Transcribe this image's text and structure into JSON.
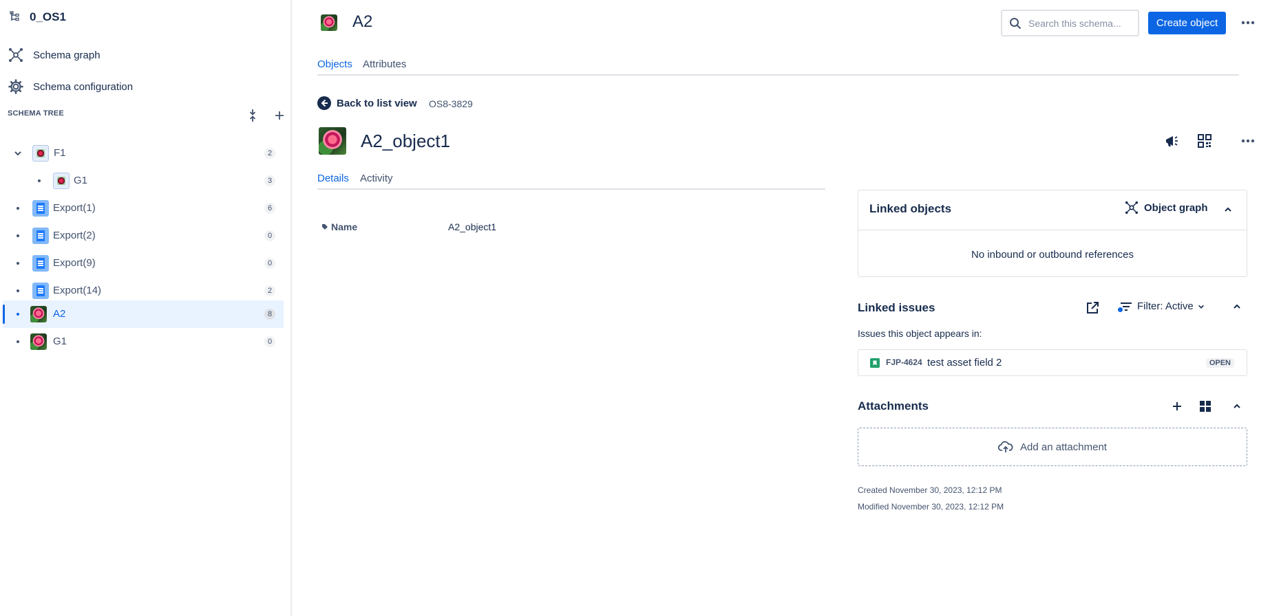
{
  "sidebar": {
    "schema_name": "0_OS1",
    "links": [
      {
        "label": "Schema graph",
        "icon": "schema-graph-icon"
      },
      {
        "label": "Schema configuration",
        "icon": "gear-icon"
      }
    ],
    "tree_heading": "SCHEMA TREE",
    "tree": [
      {
        "label": "F1",
        "count": "2"
      },
      {
        "label": "G1",
        "count": "3"
      },
      {
        "label": "Export(1)",
        "count": "6"
      },
      {
        "label": "Export(2)",
        "count": "0"
      },
      {
        "label": "Export(9)",
        "count": "0"
      },
      {
        "label": "Export(14)",
        "count": "2"
      },
      {
        "label": "A2",
        "count": "8"
      },
      {
        "label": "G1",
        "count": "0"
      }
    ]
  },
  "header": {
    "title": "A2",
    "search_placeholder": "Search this schema...",
    "create_label": "Create object",
    "tabs": [
      {
        "label": "Objects"
      },
      {
        "label": "Attributes"
      }
    ]
  },
  "object": {
    "back_label": "Back to list view",
    "key": "OS8-3829",
    "name": "A2_object1",
    "tabs": [
      {
        "label": "Details"
      },
      {
        "label": "Activity"
      }
    ],
    "attributes": [
      {
        "name": "Name",
        "value": "A2_object1"
      }
    ]
  },
  "linked_objects": {
    "title": "Linked objects",
    "graph_label": "Object graph",
    "empty_text": "No inbound or outbound references"
  },
  "linked_issues": {
    "title": "Linked issues",
    "filter_label": "Filter: Active",
    "subtitle": "Issues this object appears in:",
    "issues": [
      {
        "key": "FJP-4624",
        "summary": "test asset field 2",
        "status": "OPEN"
      }
    ]
  },
  "attachments": {
    "title": "Attachments",
    "add_label": "Add an attachment"
  },
  "meta": {
    "created": "Created November 30, 2023, 12:12 PM",
    "modified": "Modified November 30, 2023, 12:12 PM"
  },
  "colors": {
    "accent": "#0c66e4",
    "issue_type": "#22a06b",
    "text": "#172b4d"
  }
}
